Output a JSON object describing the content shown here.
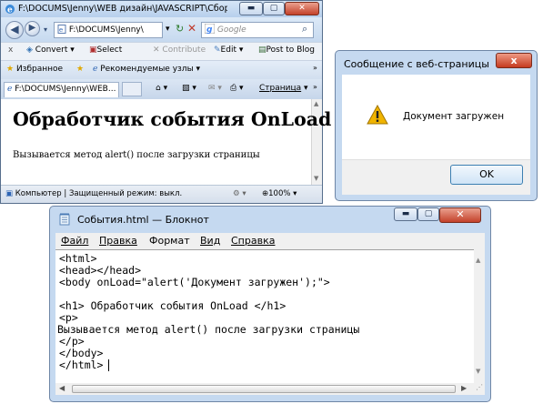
{
  "ie": {
    "title": "F:\\DOCUMS\\Jenny\\WEB дизайн\\JAVASCRIPT\\Сборник JavaScr...",
    "address": "F:\\DOCUMS\\Jenny\\",
    "search_placeholder": "Google",
    "toolbar": {
      "convert": "Convert",
      "select": "Select",
      "contribute": "Contribute",
      "edit": "Edit",
      "post_to_blog": "Post to Blog"
    },
    "favorites": {
      "label": "Избранное",
      "suggested_sites": "Рекомендуемые узлы"
    },
    "tab_label": "F:\\DOCUMS\\Jenny\\WEB...",
    "page_menu": "Страница",
    "page": {
      "heading": "Обработчик события OnLoad",
      "paragraph": "Вызывается метод alert() после загрузки страницы"
    },
    "status": {
      "zone": "Компьютер | Защищенный режим: выкл.",
      "zoom": "100%"
    }
  },
  "dialog": {
    "title": "Сообщение с веб-страницы",
    "message": "Документ загружен",
    "ok_label": "OK",
    "close_glyph": "x",
    "icon": "warning-icon"
  },
  "notepad": {
    "title": "События.html — Блокнот",
    "menu": [
      "Файл",
      "Правка",
      "Формат",
      "Вид",
      "Справка"
    ],
    "lines": [
      "<html>",
      "<head></head>",
      "<body onLoad=\"alert('Документ загружен');\">",
      "",
      "<h1> Обработчик события OnLoad </h1>",
      "<p>",
      "Вызывается метод alert() после загрузки страницы",
      "</p>",
      "</body>",
      "</html>"
    ]
  },
  "colors": {
    "window_frame": "#c5d9f0",
    "close_button": "#c53a1f",
    "warning": "#f0b400"
  }
}
